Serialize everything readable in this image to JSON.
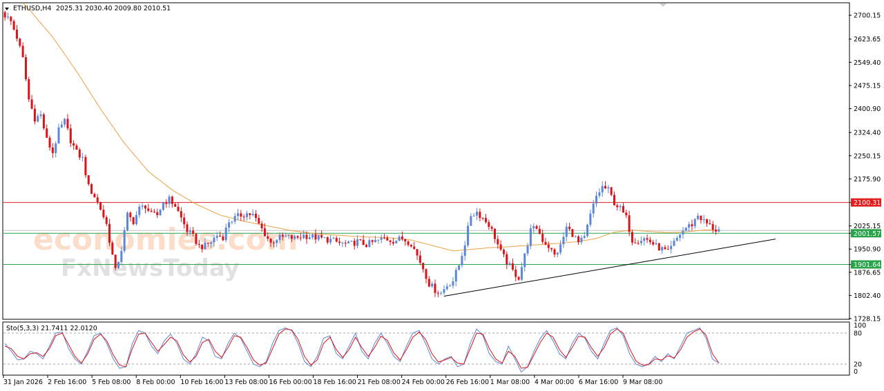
{
  "header": {
    "symbol": "ETHUSD,H4",
    "ohlc": "2025.31 2030.40 2009.80 2010.51"
  },
  "watermark": {
    "line1": "economies.com",
    "line2": "FxNewsToday"
  },
  "colors": {
    "bull": "#5b87d6",
    "bear": "#d9141a",
    "ma": "#f0a040",
    "resistance": "#e21d1d",
    "support": "#27a34a",
    "trend": "#000000",
    "stoch_main": "#5b87d6",
    "stoch_signal": "#d9141a"
  },
  "chart_data": [
    {
      "type": "candlestick",
      "title": "ETHUSD,H4",
      "ylim": [
        1728.15,
        2738.0
      ],
      "y_ticks": [
        "2700.15",
        "2623.65",
        "2549.40",
        "2475.15",
        "2400.90",
        "2324.40",
        "2250.15",
        "2175.90",
        "2100.31",
        "2025.15",
        "2001.57",
        "1950.90",
        "1901.64",
        "1876.65",
        "1802.40",
        "1728.15"
      ],
      "x_ticks": [
        "31 Jan 2026",
        "2 Feb 16:00",
        "5 Feb 08:00",
        "8 Feb 00:00",
        "10 Feb 16:00",
        "13 Feb 08:00",
        "16 Feb 00:00",
        "18 Feb 16:00",
        "21 Feb 08:00",
        "24 Feb 00:00",
        "26 Feb 16:00",
        "1 Mar 08:00",
        "4 Mar 00:00",
        "6 Mar 16:00",
        "9 Mar 08:00"
      ],
      "price_path": [
        [
          0,
          2710
        ],
        [
          3,
          2680
        ],
        [
          5,
          2630
        ],
        [
          7,
          2560
        ],
        [
          9,
          2430
        ],
        [
          11,
          2370
        ],
        [
          13,
          2380
        ],
        [
          15,
          2300
        ],
        [
          17,
          2260
        ],
        [
          19,
          2330
        ],
        [
          21,
          2360
        ],
        [
          23,
          2300
        ],
        [
          25,
          2260
        ],
        [
          27,
          2240
        ],
        [
          29,
          2150
        ],
        [
          31,
          2120
        ],
        [
          33,
          2080
        ],
        [
          35,
          2030
        ],
        [
          37,
          1930
        ],
        [
          38,
          1880
        ],
        [
          40,
          1950
        ],
        [
          42,
          2060
        ],
        [
          44,
          2040
        ],
        [
          46,
          2080
        ],
        [
          48,
          2090
        ],
        [
          50,
          2060
        ],
        [
          52,
          2060
        ],
        [
          54,
          2100
        ],
        [
          56,
          2110
        ],
        [
          58,
          2090
        ],
        [
          60,
          2050
        ],
        [
          62,
          2010
        ],
        [
          64,
          1990
        ],
        [
          66,
          1960
        ],
        [
          68,
          1960
        ],
        [
          70,
          1975
        ],
        [
          72,
          1995
        ],
        [
          74,
          1990
        ],
        [
          76,
          2040
        ],
        [
          78,
          2050
        ],
        [
          80,
          2060
        ],
        [
          82,
          2065
        ],
        [
          84,
          2060
        ],
        [
          86,
          2030
        ],
        [
          88,
          2000
        ],
        [
          90,
          1970
        ],
        [
          92,
          1985
        ],
        [
          95,
          1990
        ],
        [
          98,
          1985
        ],
        [
          101,
          1995
        ],
        [
          104,
          1990
        ],
        [
          107,
          1985
        ],
        [
          110,
          1980
        ],
        [
          113,
          1970
        ],
        [
          116,
          1965
        ],
        [
          119,
          1975
        ],
        [
          122,
          1965
        ],
        [
          125,
          1975
        ],
        [
          128,
          1985
        ],
        [
          131,
          1978
        ],
        [
          134,
          1985
        ],
        [
          137,
          1970
        ],
        [
          139,
          1930
        ],
        [
          141,
          1890
        ],
        [
          143,
          1840
        ],
        [
          145,
          1820
        ],
        [
          147,
          1810
        ],
        [
          149,
          1835
        ],
        [
          151,
          1850
        ],
        [
          153,
          1900
        ],
        [
          155,
          1970
        ],
        [
          157,
          2060
        ],
        [
          159,
          2070
        ],
        [
          161,
          2050
        ],
        [
          163,
          2030
        ],
        [
          165,
          1990
        ],
        [
          167,
          1940
        ],
        [
          169,
          1910
        ],
        [
          171,
          1880
        ],
        [
          173,
          1860
        ],
        [
          175,
          1930
        ],
        [
          177,
          2010
        ],
        [
          179,
          2020
        ],
        [
          181,
          1980
        ],
        [
          183,
          1960
        ],
        [
          185,
          1930
        ],
        [
          187,
          1960
        ],
        [
          189,
          2020
        ],
        [
          191,
          2000
        ],
        [
          193,
          1970
        ],
        [
          195,
          1985
        ],
        [
          197,
          2060
        ],
        [
          199,
          2120
        ],
        [
          201,
          2150
        ],
        [
          203,
          2140
        ],
        [
          205,
          2100
        ],
        [
          207,
          2080
        ],
        [
          209,
          2050
        ],
        [
          211,
          1980
        ],
        [
          213,
          1980
        ],
        [
          215,
          1985
        ],
        [
          217,
          1975
        ],
        [
          219,
          1960
        ],
        [
          221,
          1950
        ],
        [
          223,
          1940
        ],
        [
          225,
          1970
        ],
        [
          227,
          2000
        ],
        [
          229,
          2020
        ],
        [
          231,
          2030
        ],
        [
          233,
          2060
        ],
        [
          235,
          2040
        ],
        [
          237,
          2025
        ],
        [
          239,
          2012
        ]
      ],
      "moving_average_path": [
        [
          0,
          2800
        ],
        [
          8,
          2720
        ],
        [
          16,
          2630
        ],
        [
          24,
          2520
        ],
        [
          32,
          2400
        ],
        [
          40,
          2290
        ],
        [
          48,
          2200
        ],
        [
          56,
          2140
        ],
        [
          64,
          2095
        ],
        [
          72,
          2060
        ],
        [
          80,
          2040
        ],
        [
          88,
          2025
        ],
        [
          96,
          2010
        ],
        [
          104,
          2000
        ],
        [
          112,
          1995
        ],
        [
          120,
          1990
        ],
        [
          128,
          1988
        ],
        [
          136,
          1980
        ],
        [
          144,
          1960
        ],
        [
          150,
          1945
        ],
        [
          156,
          1950
        ],
        [
          162,
          1955
        ],
        [
          168,
          1958
        ],
        [
          174,
          1962
        ],
        [
          180,
          1966
        ],
        [
          186,
          1970
        ],
        [
          192,
          1975
        ],
        [
          198,
          1985
        ],
        [
          204,
          2005
        ],
        [
          210,
          2012
        ],
        [
          216,
          2007
        ],
        [
          222,
          2004
        ],
        [
          228,
          2006
        ],
        [
          234,
          2012
        ],
        [
          239,
          2012
        ]
      ],
      "horizontal_levels": [
        {
          "label": "2100.31",
          "value": 2100.31,
          "color": "#e21d1d"
        },
        {
          "label": "2001.57",
          "value": 2001.57,
          "color": "#27a34a"
        },
        {
          "label": "1901.64",
          "value": 1901.64,
          "color": "#27a34a"
        }
      ],
      "current_price_line": 2010.51,
      "trendline": {
        "from": [
          147,
          1800
        ],
        "to": [
          258,
          1983
        ]
      }
    },
    {
      "type": "line",
      "title": "Sto(5,3,3) 21.7411 22.0120",
      "ylim": [
        0,
        100
      ],
      "y_ticks": [
        "100",
        "80",
        "20",
        "0"
      ],
      "levels": [
        80,
        20
      ],
      "series": [
        {
          "values": [
            60,
            45,
            28,
            30,
            45,
            40,
            30,
            55,
            80,
            82,
            50,
            30,
            20,
            45,
            75,
            80,
            60,
            30,
            12,
            15,
            60,
            85,
            80,
            55,
            40,
            65,
            78,
            60,
            30,
            20,
            40,
            72,
            65,
            35,
            30,
            60,
            80,
            70,
            45,
            20,
            15,
            25,
            60,
            85,
            90,
            85,
            60,
            25,
            15,
            35,
            70,
            75,
            40,
            30,
            55,
            80,
            45,
            30,
            60,
            80,
            60,
            35,
            25,
            55,
            80,
            85,
            60,
            30,
            20,
            30,
            35,
            15,
            20,
            60,
            88,
            75,
            40,
            25,
            20,
            55,
            30,
            5,
            15,
            45,
            70,
            85,
            65,
            40,
            30,
            60,
            80,
            70,
            45,
            30,
            60,
            85,
            90,
            75,
            40,
            20,
            15,
            20,
            35,
            25,
            40,
            30,
            55,
            80,
            85,
            90,
            70,
            30,
            22
          ]
        },
        {
          "values": [
            55,
            50,
            35,
            30,
            40,
            42,
            35,
            50,
            75,
            80,
            58,
            35,
            22,
            40,
            68,
            78,
            65,
            38,
            18,
            15,
            50,
            78,
            80,
            62,
            45,
            58,
            72,
            65,
            38,
            24,
            35,
            62,
            68,
            45,
            33,
            52,
            75,
            72,
            52,
            28,
            18,
            22,
            50,
            78,
            88,
            86,
            68,
            35,
            18,
            28,
            60,
            72,
            48,
            33,
            48,
            72,
            52,
            35,
            52,
            74,
            66,
            42,
            28,
            48,
            72,
            82,
            68,
            40,
            24,
            28,
            33,
            22,
            20,
            50,
            80,
            78,
            50,
            30,
            22,
            45,
            35,
            12,
            14,
            38,
            62,
            80,
            72,
            48,
            33,
            52,
            74,
            72,
            52,
            35,
            52,
            78,
            88,
            80,
            50,
            26,
            18,
            19,
            30,
            28,
            36,
            32,
            48,
            72,
            82,
            88,
            76,
            40,
            22
          ]
        }
      ]
    }
  ]
}
